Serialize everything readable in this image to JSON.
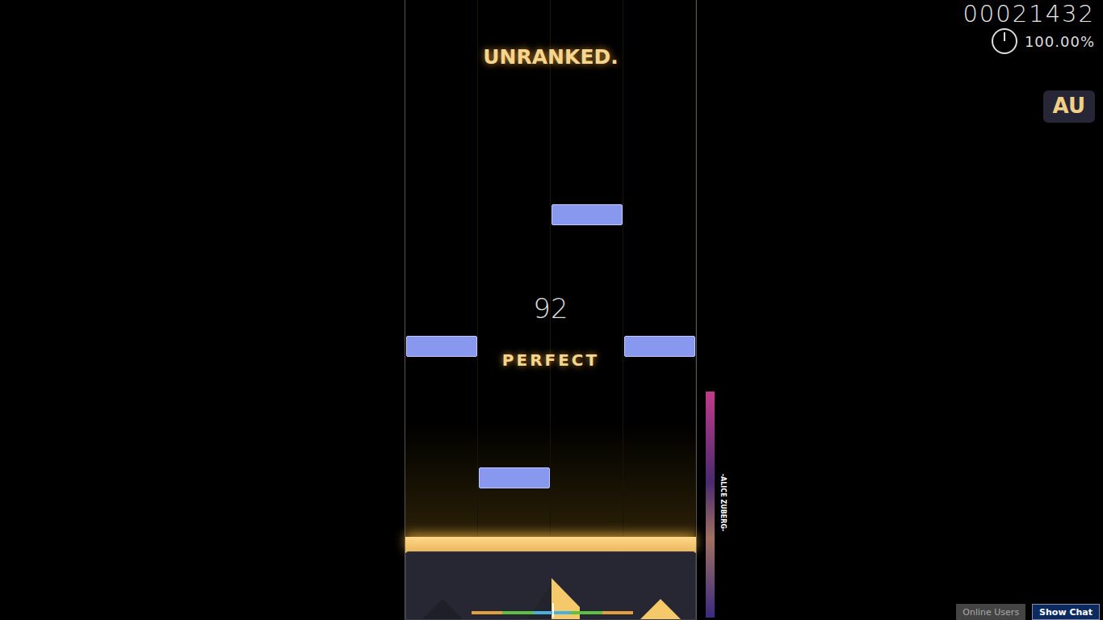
{
  "status": "UNRANKED.",
  "score": "00021432",
  "accuracy": "100.00%",
  "mods": [
    "AU"
  ],
  "combo": "92",
  "judgement": "PERFECT",
  "lanes": [
    {
      "lit": true
    },
    {
      "lit": true
    },
    {
      "lit": true
    },
    {
      "lit": true
    }
  ],
  "notes": [
    {
      "lane": 3,
      "level": 0.6
    },
    {
      "lane": 1,
      "level": 0.355
    },
    {
      "lane": 4,
      "level": 0.355
    },
    {
      "lane": 2,
      "level": 0.11
    }
  ],
  "hit_error": {
    "level": 0.5
  },
  "song": {
    "artist": "-ALICE ZUBERG-"
  },
  "buttons": [
    "Online Users",
    "Show Chat"
  ]
}
